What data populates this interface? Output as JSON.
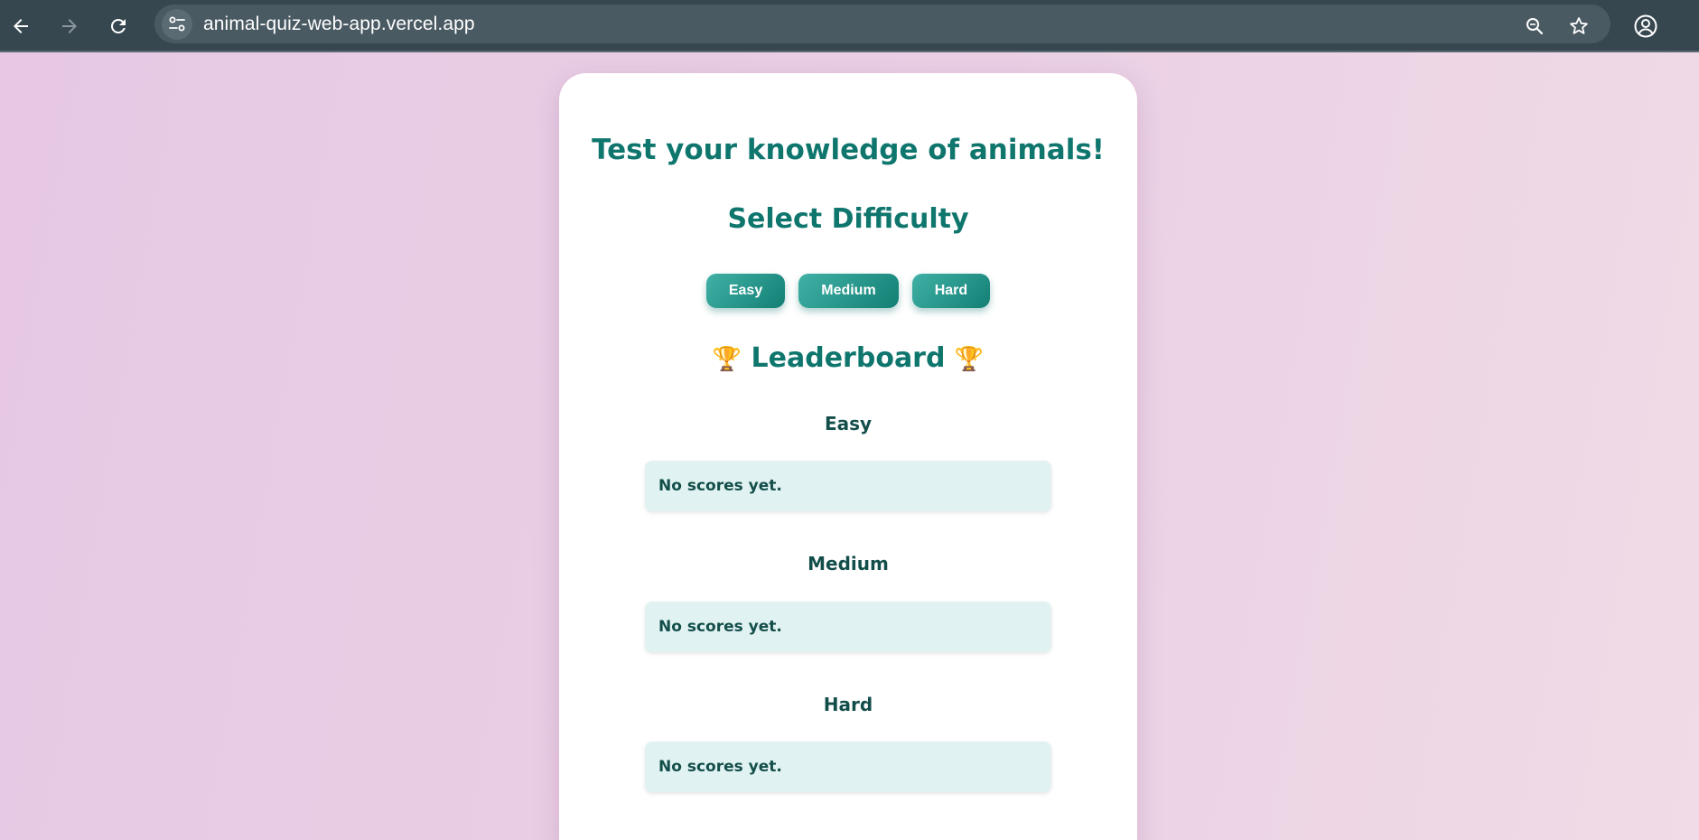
{
  "browser": {
    "url": "animal-quiz-web-app.vercel.app",
    "icons": [
      "back-arrow-icon",
      "forward-arrow-icon",
      "reload-icon",
      "site-info-icon",
      "zoom-icon",
      "bookmark-star-icon",
      "profile-icon"
    ]
  },
  "quiz": {
    "title": "Test your knowledge of animals!",
    "select_heading": "Select Difficulty",
    "difficulty_buttons": [
      "Easy",
      "Medium",
      "Hard"
    ],
    "leaderboard": {
      "trophy": "🏆",
      "heading": "Leaderboard",
      "levels": [
        {
          "name": "Easy",
          "message": "No scores yet."
        },
        {
          "name": "Medium",
          "message": "No scores yet."
        },
        {
          "name": "Hard",
          "message": "No scores yet."
        }
      ]
    }
  },
  "colors": {
    "toolbar": "#37474f",
    "accent_teal": "#0f766e",
    "score_box": "#e0f2f1",
    "page_background": "#e8cbe3"
  }
}
